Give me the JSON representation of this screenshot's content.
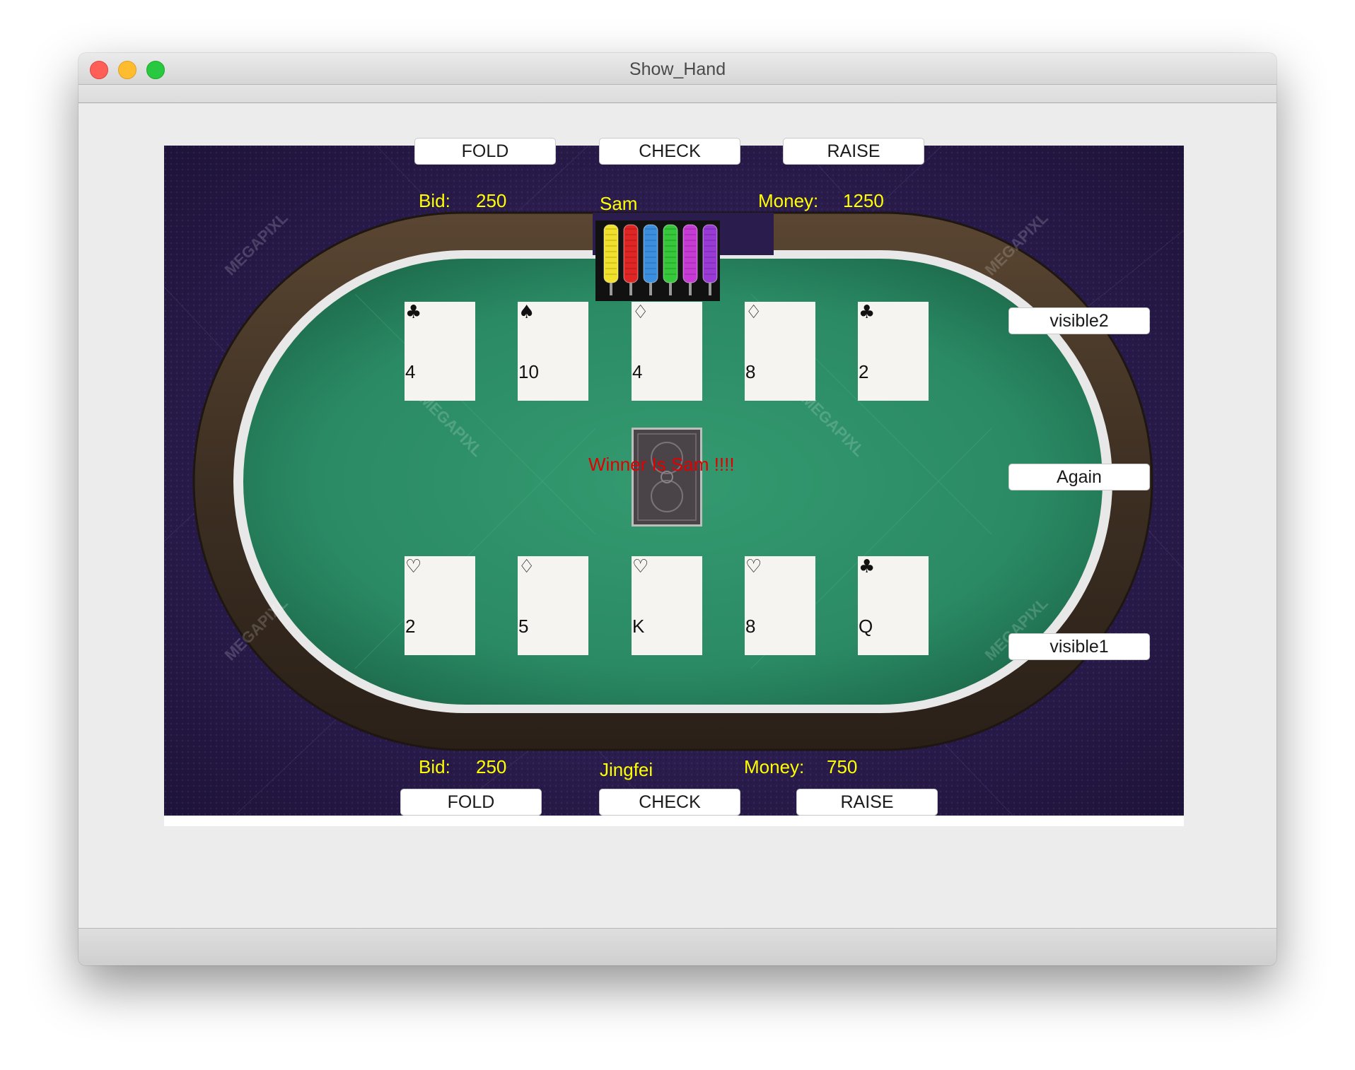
{
  "window": {
    "title": "Show_Hand"
  },
  "top_player": {
    "name": "Sam",
    "bid_label": "Bid:",
    "bid_value": "250",
    "money_label": "Money:",
    "money_value": "1250",
    "buttons": {
      "fold": "FOLD",
      "check": "CHECK",
      "raise": "RAISE"
    },
    "cards": [
      {
        "suit": "♣",
        "rank": "4"
      },
      {
        "suit": "♠",
        "rank": "10"
      },
      {
        "suit": "♢",
        "rank": "4"
      },
      {
        "suit": "♢",
        "rank": "8"
      },
      {
        "suit": "♣",
        "rank": "2"
      }
    ]
  },
  "bottom_player": {
    "name": "Jingfei",
    "bid_label": "Bid:",
    "bid_value": "250",
    "money_label": "Money:",
    "money_value": "750",
    "buttons": {
      "fold": "FOLD",
      "check": "CHECK",
      "raise": "RAISE"
    },
    "cards": [
      {
        "suit": "♡",
        "rank": "2"
      },
      {
        "suit": "♢",
        "rank": "5"
      },
      {
        "suit": "♡",
        "rank": "K"
      },
      {
        "suit": "♡",
        "rank": "8"
      },
      {
        "suit": "♣",
        "rank": "Q"
      }
    ]
  },
  "side_buttons": {
    "visible2": "visible2",
    "again": "Again",
    "visible1": "visible1"
  },
  "status": {
    "winner": "Winner Is Sam !!!!"
  },
  "watermark": "MEGAPIXL",
  "colors": {
    "felt": "#2a8a64",
    "background": "#2a1c4c",
    "label": "#ffff00",
    "winner": "#e00000",
    "chips": [
      "#f2e12a",
      "#e02525",
      "#3b8fe0",
      "#35c83a",
      "#c83ad6",
      "#9a3ad6"
    ]
  }
}
